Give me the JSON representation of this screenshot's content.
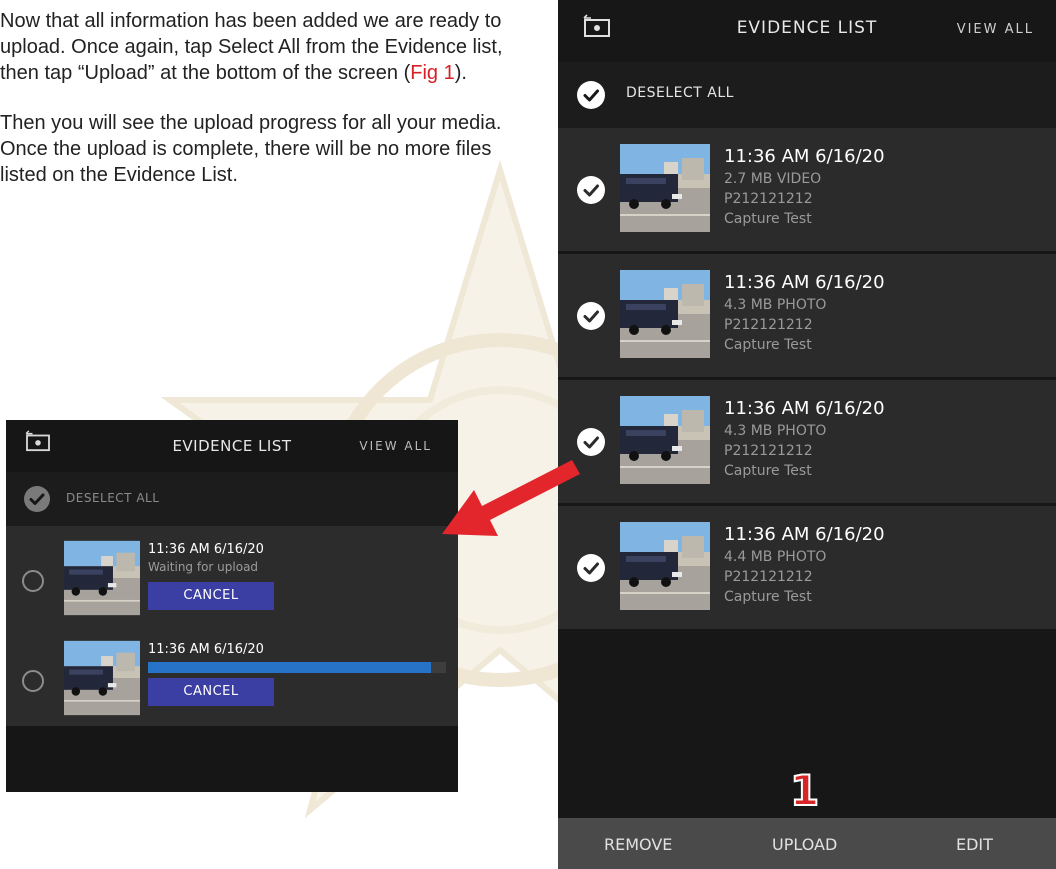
{
  "instructions": {
    "p1_pre": "Now that all information has been added we are ready to upload. Once again, tap Select All from the Evidence list, then tap “Upload” at the bottom of the screen (",
    "p1_ref": "Fig 1",
    "p1_post": ").",
    "p2": "Then you will see the upload progress for all your media. Once the upload is complete, there will be no more files listed on the Evidence List."
  },
  "main_phone": {
    "title": "EVIDENCE LIST",
    "view_all": "VIEW ALL",
    "deselect_all": "DESELECT ALL",
    "items": [
      {
        "time": "11:36 AM 6/16/20",
        "size_type": "2.7 MB VIDEO",
        "id": "P212121212",
        "note": "Capture Test",
        "checked": true
      },
      {
        "time": "11:36 AM 6/16/20",
        "size_type": "4.3 MB PHOTO",
        "id": "P212121212",
        "note": "Capture Test",
        "checked": true
      },
      {
        "time": "11:36 AM 6/16/20",
        "size_type": "4.3 MB PHOTO",
        "id": "P212121212",
        "note": "Capture Test",
        "checked": true
      },
      {
        "time": "11:36 AM 6/16/20",
        "size_type": "4.4 MB PHOTO",
        "id": "P212121212",
        "note": "Capture Test",
        "checked": true
      }
    ],
    "fig_number": "1",
    "bottom": {
      "remove": "REMOVE",
      "upload": "UPLOAD",
      "edit": "EDIT"
    }
  },
  "progress_phone": {
    "title": "EVIDENCE LIST",
    "view_all": "VIEW ALL",
    "deselect_all": "DESELECT ALL",
    "rows": [
      {
        "time": "11:36 AM 6/16/20",
        "status": "Waiting for upload",
        "cancel": "CANCEL"
      },
      {
        "time": "11:36 AM 6/16/20",
        "progress": 0.95,
        "cancel": "CANCEL"
      }
    ]
  },
  "colors": {
    "accent_red": "#d91f26",
    "cancel_blue": "#3b3ea3",
    "progress_blue": "#2673c8"
  }
}
